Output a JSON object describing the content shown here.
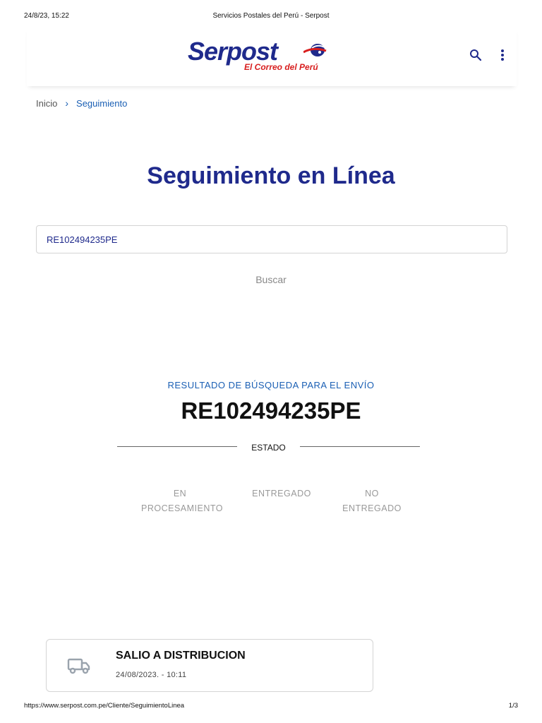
{
  "print_header": {
    "date": "24/8/23, 15:22",
    "title": "Servicios Postales del Perú - Serpost"
  },
  "header": {
    "logo_text": "Serpost",
    "logo_tagline": "El Correo del Perú",
    "icons": [
      "search-icon",
      "more-vertical-icon"
    ],
    "accent_color": "#1f2a8c",
    "brand_red": "#d81e1e"
  },
  "breadcrumb": {
    "home": "Inicio",
    "current": "Seguimiento"
  },
  "page_title": "Seguimiento en Línea",
  "search": {
    "value": "RE102494235PE",
    "button_label": "Buscar"
  },
  "result": {
    "label": "RESULTADO DE BÚSQUEDA PARA EL ENVÍO",
    "code": "RE102494235PE",
    "estado_label": "ESTADO",
    "steps": [
      {
        "line1": "EN",
        "line2": "PROCESAMIENTO"
      },
      {
        "line1": "ENTREGADO",
        "line2": ""
      },
      {
        "line1": "NO",
        "line2": "ENTREGADO"
      }
    ]
  },
  "events": [
    {
      "icon": "truck-icon",
      "title": "SALIO A DISTRIBUCION",
      "datetime": "24/08/2023. - 10:11"
    }
  ],
  "print_footer": {
    "url": "https://www.serpost.com.pe/Cliente/SeguimientoLinea",
    "page": "1/3"
  }
}
